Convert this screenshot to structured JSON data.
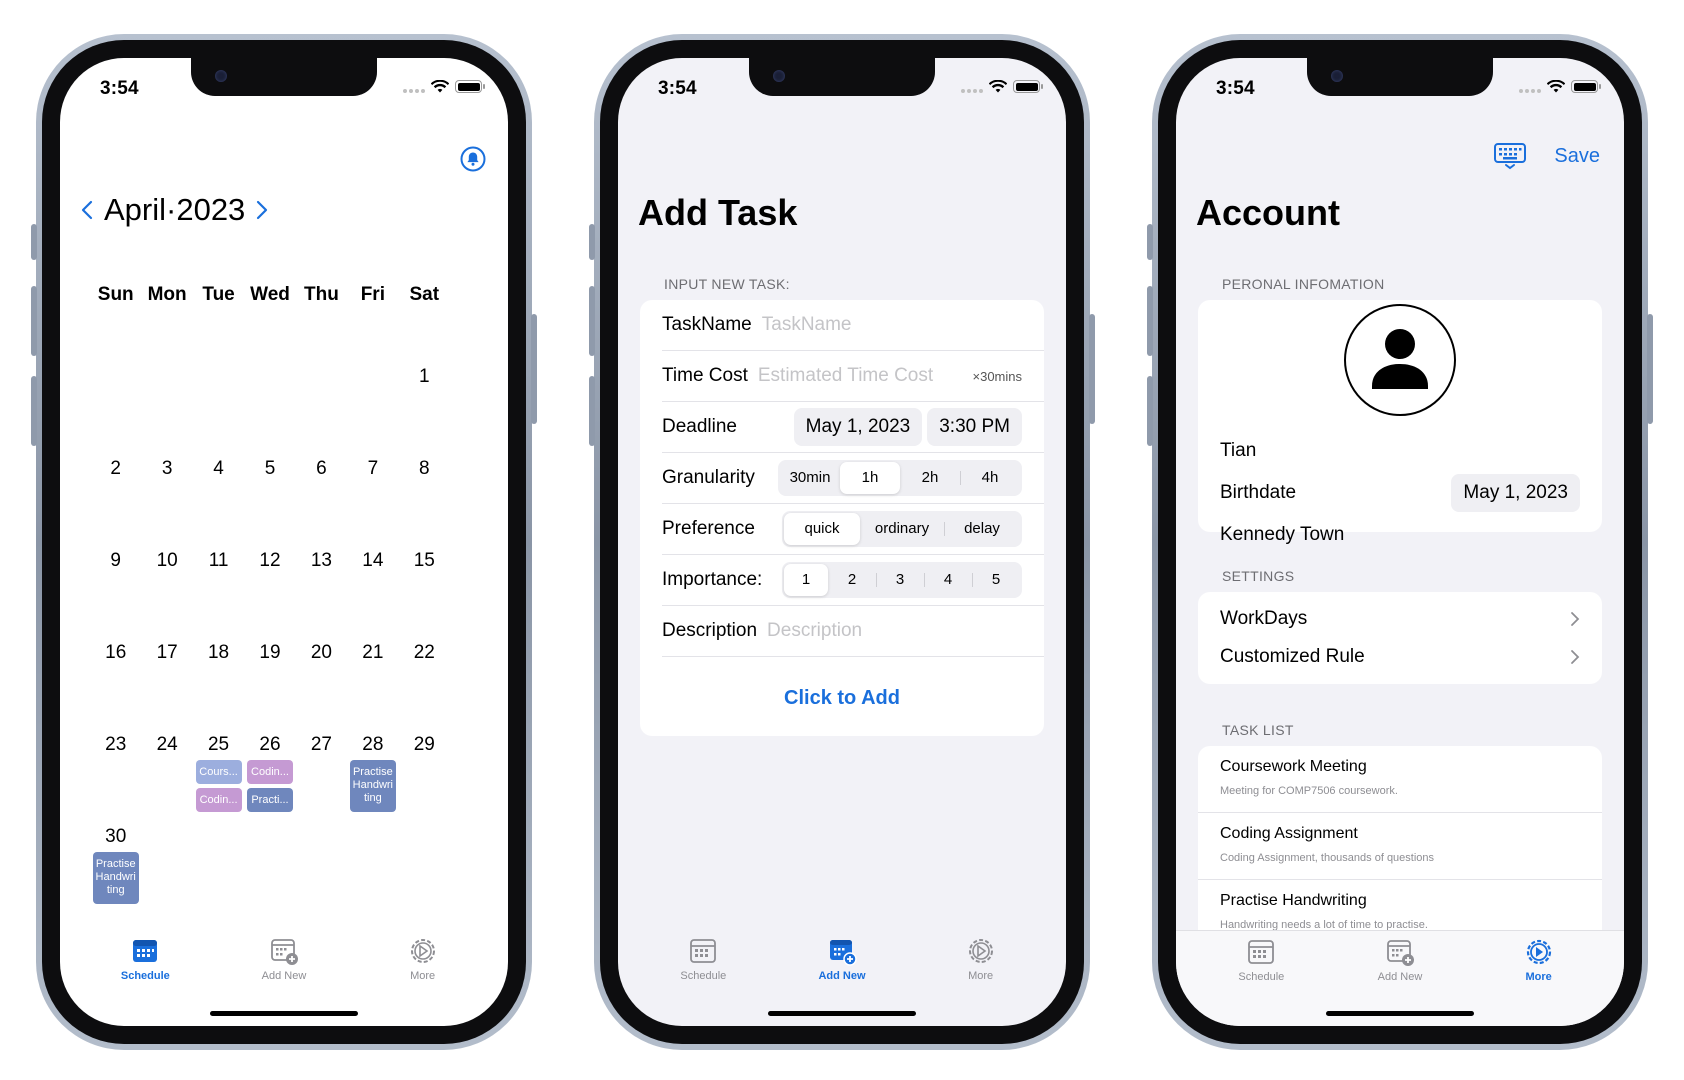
{
  "status": {
    "time": "3:54"
  },
  "tabs": {
    "schedule": "Schedule",
    "add_new": "Add New",
    "more": "More"
  },
  "calendar": {
    "month_title": "April·2023",
    "prev": "<",
    "next": ">",
    "weekdays": [
      "Sun",
      "Mon",
      "Tue",
      "Wed",
      "Thu",
      "Fri",
      "Sat"
    ],
    "days": [
      "1",
      "2",
      "3",
      "4",
      "5",
      "6",
      "7",
      "8",
      "9",
      "10",
      "11",
      "12",
      "13",
      "14",
      "15",
      "16",
      "17",
      "18",
      "19",
      "20",
      "21",
      "22",
      "23",
      "24",
      "25",
      "26",
      "27",
      "28",
      "29",
      "30"
    ],
    "events": {
      "d25_a": "Cours...",
      "d25_b": "Codin...",
      "d26_a": "Codin...",
      "d26_b": "Practi...",
      "d28": "Practise Handwri ting",
      "d30": "Practise Handwri ting"
    }
  },
  "add_task": {
    "title": "Add Task",
    "section": "INPUT NEW TASK:",
    "task_name_label": "TaskName",
    "task_name_placeholder": "TaskName",
    "time_cost_label": "Time Cost",
    "time_cost_placeholder": "Estimated Time Cost",
    "time_cost_suffix": "×30mins",
    "deadline_label": "Deadline",
    "deadline_date": "May 1, 2023",
    "deadline_time": "3:30 PM",
    "granularity_label": "Granularity",
    "granularity_options": [
      "30min",
      "1h",
      "2h",
      "4h"
    ],
    "preference_label": "Preference",
    "preference_options": [
      "quick",
      "ordinary",
      "delay"
    ],
    "importance_label": "Importance:",
    "importance_options": [
      "1",
      "2",
      "3",
      "4",
      "5"
    ],
    "description_label": "Description",
    "description_placeholder": "Description",
    "add_button": "Click to Add"
  },
  "account": {
    "title": "Account",
    "save": "Save",
    "personal_section": "PERONAL INFOMATION",
    "name": "Tian",
    "birthdate_label": "Birthdate",
    "birthdate": "May 1, 2023",
    "location": "Kennedy Town",
    "settings_section": "SETTINGS",
    "settings": [
      "WorkDays",
      "Customized Rule"
    ],
    "tasklist_section": "TASK LIST",
    "tasks": [
      {
        "title": "Coursework Meeting",
        "desc": "Meeting for COMP7506 coursework."
      },
      {
        "title": "Coding Assignment",
        "desc": "Coding Assignment, thousands of questions"
      },
      {
        "title": "Practise Handwriting",
        "desc": "Handwriting needs a lot of time to practise."
      }
    ]
  },
  "colors": {
    "accent": "#1a6fdc",
    "event_light": "#9caede",
    "event_purple": "#c59ad3",
    "event_dark": "#6f87bd"
  }
}
